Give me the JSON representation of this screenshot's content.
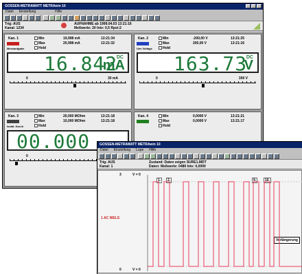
{
  "colors": {
    "title_bg": "#0a246a",
    "lcd_text": "#1e7a3a",
    "wave": "#ea3a5a",
    "ch1": "#c81e1e",
    "ch2": "#2040c0"
  },
  "back_window": {
    "title": "GOSSEN-METRAWATT        METRAwin 10",
    "menu": [
      "Datei",
      "Einstellung",
      "Hilfe"
    ],
    "info": {
      "trig": "Trig: AUS",
      "kanal": "Kanal: 1234",
      "aufnahme": "AUFNAHME ab 1999.04.03  13:21:16",
      "messwerte": "Meßwerte: 20   Intv: 0,5   Rpst:2"
    },
    "panels": [
      {
        "kanal": "Kan. 1",
        "min": "Min",
        "max": "Max",
        "hold": "Hold",
        "min_val": "19,998 mA",
        "max_val": "20,998 mA",
        "min_time": "13:21:34",
        "max_time": "13:21:32",
        "label": "Messaufgabe",
        "display": "16.842",
        "dc": "DC",
        "unit": "mA",
        "scale_lo": "0",
        "scale_hi": "30 mA",
        "pointer": 0.56
      },
      {
        "kanal": "Kan. 2",
        "min": "Min",
        "max": "Max",
        "hold": "Hold",
        "min_val": "-200,00 V",
        "max_val": "200,00 V",
        "min_time": "13:21:25",
        "max_time": "13:21:16",
        "label": "Uen Voltage",
        "display": "163.73",
        "dc": "DC",
        "unit": "V",
        "scale_lo": "0",
        "scale_hi": "300 V",
        "pointer": 0.55
      },
      {
        "kanal": "Kan. 3",
        "min": "Min",
        "max": "Max",
        "hold": "Hold",
        "min_val": "20,000 MOhm",
        "max_val": "10,000 MOhm",
        "min_time": "13:21:18",
        "max_time": "13:21:18",
        "label": "Isolat. Durch",
        "display": "00.000",
        "scale_lo": "0",
        "pointer": 0.05
      },
      {
        "kanal": "Kan. 4",
        "min": "Min",
        "max": "Max",
        "hold": "Hold",
        "min_val": "0,0000 V",
        "max_val": "0,0000 V",
        "min_time": "13:21:21",
        "max_time": "13:21:17"
      }
    ]
  },
  "front_window": {
    "title": "GOSSEN-METRAWATT        METRAwin 10",
    "menu": [
      "Datei",
      "Einstellung",
      "Lupe",
      "Hilfe"
    ],
    "info": {
      "trig": "Trig: AUS",
      "kanal": "Kanal: 1",
      "zustand": "Zustand:   Daten zeigen SURE1.MDT",
      "daten": "Daten:   Meßwerte: 0489   Intv: 0,0000"
    },
    "y_top": "3",
    "y_bottom": "0",
    "y_marker_top": "V = 0",
    "y_marker_bottom": "V = 0",
    "ch_label": "1  AC WELS",
    "markers": [
      "1.",
      "2.",
      "9.",
      "10."
    ],
    "tooltip": "Verlängerung"
  }
}
